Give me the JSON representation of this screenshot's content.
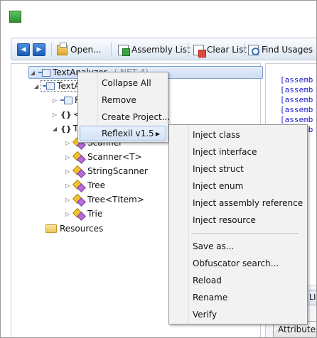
{
  "toolbar": {
    "open_label": "Open...",
    "assembly_list_label": "Assembly List",
    "clear_list_label": "Clear List",
    "find_usages_label": "Find Usages"
  },
  "tree": {
    "root": {
      "name": "TextAnalyzer",
      "version": "(.NET 4)"
    },
    "child": "TextAn",
    "row_r": "R",
    "ns1": "<",
    "ns2": "T",
    "items": [
      "Scanner",
      "Scanner<T>",
      "StringScanner",
      "Tree",
      "Tree<TItem>",
      "Trie"
    ],
    "resources": "Resources"
  },
  "code_panel": {
    "lines": [
      "[assemb",
      "[assemb",
      "[assemb",
      "[assemb",
      "[assemb",
      "[assemb"
    ],
    "tab_label": "LI",
    "attributes_label": "Attributes"
  },
  "context_menu": {
    "items": [
      "Collapse All",
      "Remove",
      "Create Project...",
      "Reflexil v1.5"
    ]
  },
  "reflexil_menu": {
    "group1": [
      "Inject class",
      "Inject interface",
      "Inject struct",
      "Inject enum",
      "Inject assembly reference",
      "Inject resource"
    ],
    "group2": [
      "Save as...",
      "Obfuscator search...",
      "Reload",
      "Rename",
      "Verify"
    ]
  }
}
